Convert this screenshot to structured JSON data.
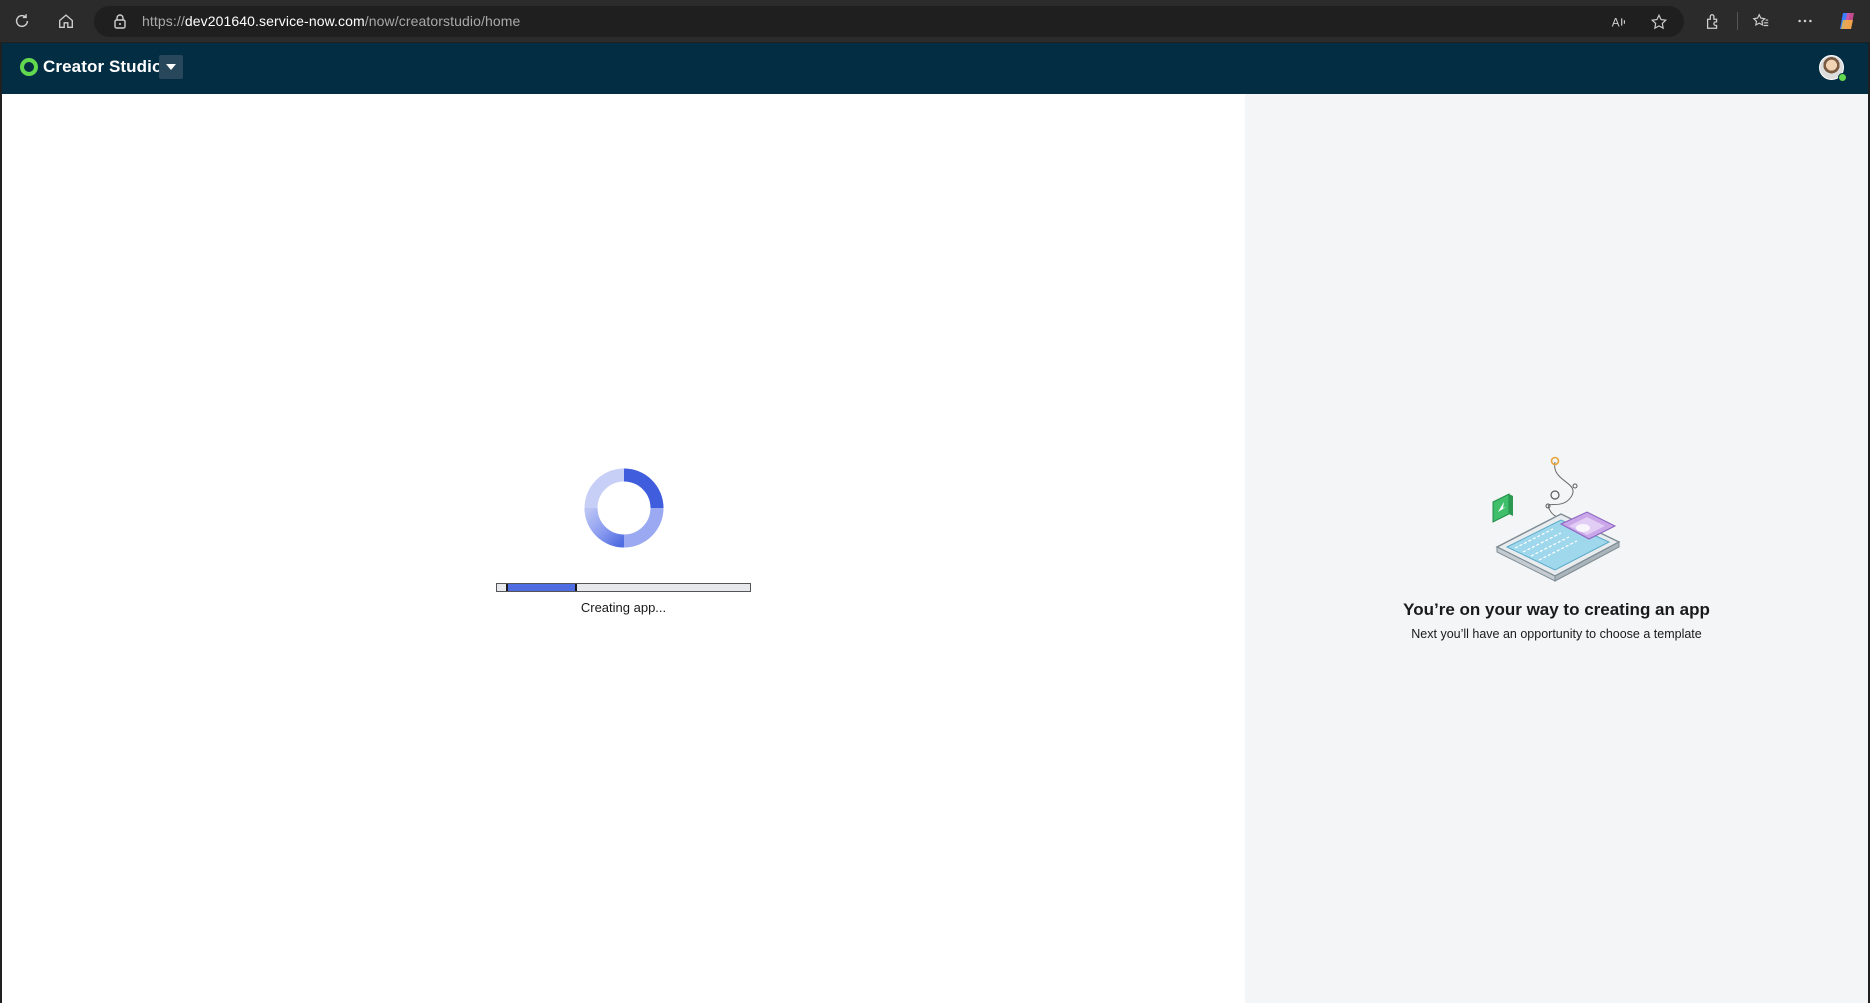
{
  "browser": {
    "url_prefix": "https://",
    "url_host": "dev201640.service-now.com",
    "url_path": "/now/creatorstudio/home",
    "icons": [
      "refresh-icon",
      "home-icon",
      "lock-icon",
      "read-aloud-icon",
      "favorite-star-icon",
      "extensions-icon",
      "favorites-icon",
      "more-icon",
      "copilot-icon"
    ]
  },
  "app": {
    "title": "Creator Studio"
  },
  "loader": {
    "progress_fraction": 0.28,
    "status_text": "Creating app..."
  },
  "panel": {
    "title": "You’re on your way to creating an app",
    "subtitle": "Next you’ll have an opportunity to choose a template"
  },
  "colors": {
    "header_bg": "#032d42",
    "brand_green": "#62d84e",
    "accent_blue": "#4f6ce0",
    "panel_bg": "#f4f5f7"
  }
}
